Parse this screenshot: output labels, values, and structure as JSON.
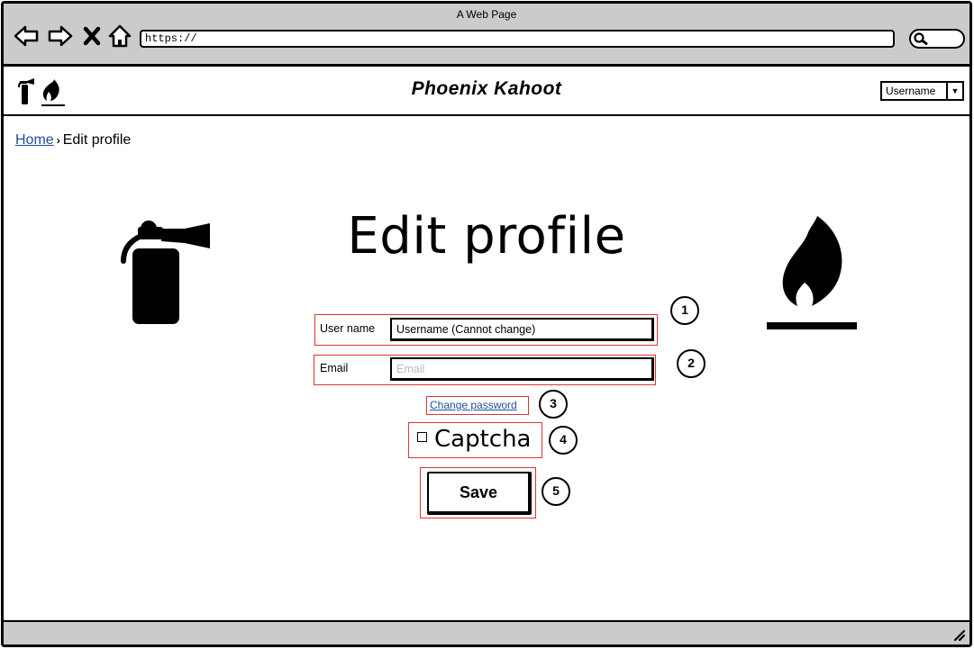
{
  "window": {
    "title": "A Web Page"
  },
  "browser": {
    "url": "https://"
  },
  "header": {
    "app_title": "Phoenix Kahoot",
    "user_dropdown": "Username"
  },
  "breadcrumb": {
    "home": "Home",
    "current": "Edit profile"
  },
  "page": {
    "title": "Edit profile"
  },
  "form": {
    "username_label": "User name",
    "username_value": "Username (Cannot change)",
    "email_label": "Email",
    "email_placeholder": "Email",
    "change_password": "Change password",
    "captcha": "Captcha",
    "save": "Save"
  },
  "annotations": [
    "1",
    "2",
    "3",
    "4",
    "5"
  ]
}
